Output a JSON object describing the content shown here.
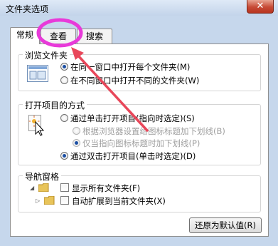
{
  "window": {
    "title": "文件夹选项",
    "close_glyph": "✕"
  },
  "tabs": [
    {
      "label": "常规",
      "active": true
    },
    {
      "label": "查看",
      "active": false
    },
    {
      "label": "搜索",
      "active": false
    }
  ],
  "browse": {
    "title": "浏览文件夹",
    "options": [
      {
        "label": "在同一窗口中打开每个文件夹(M)",
        "checked": true
      },
      {
        "label": "在不同窗口中打开不同的文件夹(W)",
        "checked": false
      }
    ]
  },
  "click_items": {
    "title": "打开项目的方式",
    "options": [
      {
        "label": "通过单击打开项目(指向时选定)(S)",
        "checked": false,
        "enabled": true
      },
      {
        "label": "根据浏览器设置给图标标题加下划线(B)",
        "checked": false,
        "enabled": false
      },
      {
        "label": "仅当指向图标标题时加下划线(P)",
        "checked": true,
        "enabled": false
      },
      {
        "label": "通过双击打开项目(单击时选定)(D)",
        "checked": true,
        "enabled": true
      }
    ]
  },
  "nav_pane": {
    "title": "导航窗格",
    "options": [
      {
        "label": "显示所有文件夹(F)",
        "checked": false
      },
      {
        "label": "自动扩展到当前文件夹(X)",
        "checked": false
      }
    ]
  },
  "restore_defaults_label": "还原为默认值(R)",
  "annotation": {
    "highlight_color": "#e83ad9",
    "arrow_color": "#e8475a"
  }
}
